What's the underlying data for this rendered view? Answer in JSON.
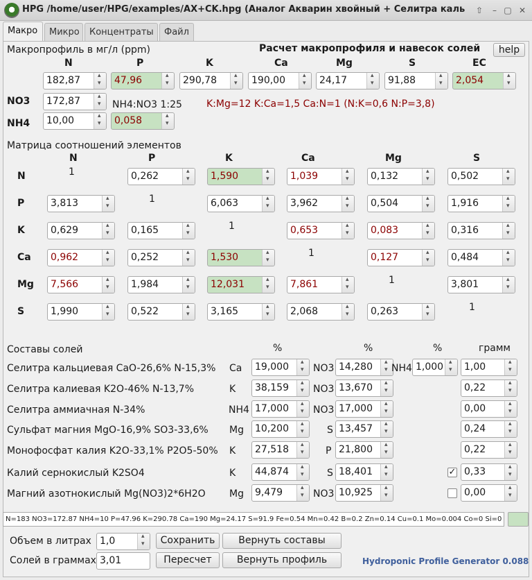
{
  "window": {
    "title": "HPG /home/user/HPG/examples/AX+CK.hpg (Аналог Акварин хвойный + Селитра кальциевая"
  },
  "tabs": [
    "Макро",
    "Микро",
    "Концентраты",
    "Файл"
  ],
  "macro": {
    "profile_label": "Макропрофиль в мг/л (ppm)",
    "calc_title": "Расчет макропрофиля и навесок солей",
    "help": "help",
    "headers": [
      "N",
      "P",
      "K",
      "Ca",
      "Mg",
      "S",
      "EC"
    ],
    "values": [
      "182,87",
      "47,96",
      "290,78",
      "190,00",
      "24,17",
      "91,88",
      "2,054"
    ],
    "no3_label": "NO3",
    "no3": "172,87",
    "nh4_label": "NH4",
    "nh4": "10,00",
    "ratio_label": "NH4:NO3 1:25",
    "ratio_val": "0,058",
    "ratios_text": "K:Mg=12 K:Ca=1,5 Ca:N=1 (N:K=0,6 N:P=3,8)"
  },
  "matrix": {
    "title": "Матрица соотношений элементов",
    "cols": [
      "N",
      "P",
      "K",
      "Ca",
      "Mg",
      "S"
    ],
    "rows": [
      {
        "name": "N",
        "cells": [
          "1",
          "0,262",
          "1,590",
          "1,039",
          "0,132",
          "0,502"
        ]
      },
      {
        "name": "P",
        "cells": [
          "3,813",
          "1",
          "6,063",
          "3,962",
          "0,504",
          "1,916"
        ]
      },
      {
        "name": "K",
        "cells": [
          "0,629",
          "0,165",
          "1",
          "0,653",
          "0,083",
          "0,316"
        ]
      },
      {
        "name": "Ca",
        "cells": [
          "0,962",
          "0,252",
          "1,530",
          "1",
          "0,127",
          "0,484"
        ]
      },
      {
        "name": "Mg",
        "cells": [
          "7,566",
          "1,984",
          "12,031",
          "7,861",
          "1",
          "3,801"
        ]
      },
      {
        "name": "S",
        "cells": [
          "1,990",
          "0,522",
          "3,165",
          "2,068",
          "0,263",
          "1"
        ]
      }
    ]
  },
  "salts": {
    "title": "Составы солей",
    "pct": "%",
    "gram": "грамм",
    "rows": [
      {
        "name": "Селитра кальциевая CaO-26,6% N-15,3%",
        "e1": "Ca",
        "v1": "19,000",
        "e2": "NO3",
        "v2": "14,280",
        "e3": "NH4",
        "v3": "1,000",
        "g": "1,00",
        "checked": null
      },
      {
        "name": "Селитра калиевая K2O-46% N-13,7%",
        "e1": "K",
        "v1": "38,159",
        "e2": "NO3",
        "v2": "13,670",
        "e3": "",
        "v3": "",
        "g": "0,22",
        "checked": null
      },
      {
        "name": "Селитра аммиачная N-34%",
        "e1": "NH4",
        "v1": "17,000",
        "e2": "NO3",
        "v2": "17,000",
        "e3": "",
        "v3": "",
        "g": "0,00",
        "checked": null
      },
      {
        "name": "Сульфат магния MgO-16,9% SO3-33,6%",
        "e1": "Mg",
        "v1": "10,200",
        "e2": "S",
        "v2": "13,457",
        "e3": "",
        "v3": "",
        "g": "0,24",
        "checked": null
      },
      {
        "name": "Монофосфат калия K2O-33,1% P2O5-50%",
        "e1": "K",
        "v1": "27,518",
        "e2": "P",
        "v2": "21,800",
        "e3": "",
        "v3": "",
        "g": "0,22",
        "checked": null
      },
      {
        "name": "Калий сернокислый K2SO4",
        "e1": "K",
        "v1": "44,874",
        "e2": "S",
        "v2": "18,401",
        "e3": "",
        "v3": "",
        "g": "0,33",
        "checked": true
      },
      {
        "name": "Магний азотнокислый Mg(NO3)2*6H2O",
        "e1": "Mg",
        "v1": "9,479",
        "e2": "NO3",
        "v2": "10,925",
        "e3": "",
        "v3": "",
        "g": "0,00",
        "checked": false
      }
    ]
  },
  "status": "N=183 NO3=172.87 NH4=10 P=47.96 K=290.78 Ca=190 Mg=24.17 S=91.9 Fe=0.54 Mn=0.42 B=0.2 Zn=0.14 Cu=0.1 Mo=0.004 Co=0 Si=0",
  "bottom": {
    "volume_label": "Объем в литрах",
    "volume": "1,0",
    "salts_label": "Солей в граммах:",
    "salts": "3,01",
    "save": "Сохранить",
    "recalc": "Пересчет",
    "revert_comp": "Вернуть составы",
    "revert_prof": "Вернуть профиль",
    "brand": "Hydroponic Profile Generator 0.088"
  },
  "colors": {
    "highlight": "#c7e2c2",
    "warn_text": "#8b0000",
    "brand": "#3f5f9c"
  }
}
